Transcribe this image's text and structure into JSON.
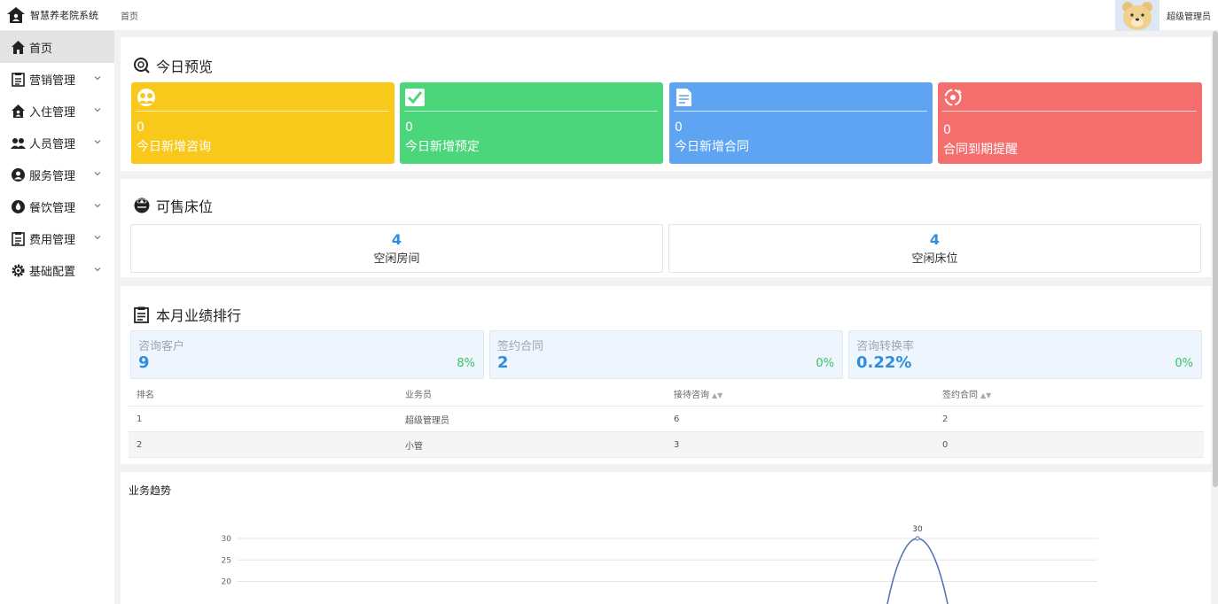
{
  "app": {
    "title": "智慧养老院系统",
    "logo_icon": "house-icon"
  },
  "breadcrumb": "首页",
  "user": {
    "name": "超级管理员",
    "avatar_icon": "bear-avatar"
  },
  "sidebar": {
    "items": [
      {
        "label": "首页",
        "icon": "home-icon",
        "active": true
      },
      {
        "label": "营销管理",
        "icon": "clipboard-icon"
      },
      {
        "label": "入住管理",
        "icon": "house-icon"
      },
      {
        "label": "人员管理",
        "icon": "users-icon"
      },
      {
        "label": "服务管理",
        "icon": "service-icon"
      },
      {
        "label": "餐饮管理",
        "icon": "drop-icon"
      },
      {
        "label": "费用管理",
        "icon": "clipboard-icon"
      },
      {
        "label": "基础配置",
        "icon": "gear-icon"
      }
    ]
  },
  "overview": {
    "title": "今日预览",
    "tiles": [
      {
        "value": "0",
        "label": "今日新增咨询",
        "color": "#f8c81a",
        "icon": "users-icon"
      },
      {
        "value": "0",
        "label": "今日新增预定",
        "color": "#4cd67c",
        "icon": "check-icon"
      },
      {
        "value": "0",
        "label": "今日新增合同",
        "color": "#5ea4f2",
        "icon": "document-icon"
      },
      {
        "value": "0",
        "label": "合同到期提醒",
        "color": "#f56e6e",
        "icon": "reminder-icon"
      }
    ]
  },
  "beds": {
    "title": "可售床位",
    "items": [
      {
        "value": "4",
        "label": "空闲房间"
      },
      {
        "value": "4",
        "label": "空闲床位"
      }
    ]
  },
  "ranking": {
    "title": "本月业绩排行",
    "stats": [
      {
        "label": "咨询客户",
        "value": "9",
        "pct": "8%"
      },
      {
        "label": "签约合同",
        "value": "2",
        "pct": "0%"
      },
      {
        "label": "咨询转换率",
        "value": "0.22%",
        "pct": "0%"
      }
    ],
    "columns": [
      "排名",
      "业务员",
      "接待咨询",
      "签约合同"
    ],
    "rows": [
      [
        "1",
        "超级管理员",
        "6",
        "2"
      ],
      [
        "2",
        "小管",
        "3",
        "0"
      ]
    ]
  },
  "trend": {
    "title": "业务趋势",
    "accent": "#4a6fb5"
  },
  "chart_data": {
    "type": "line",
    "title": "业务趋势",
    "y_ticks": [
      30,
      25,
      20
    ],
    "series": [
      {
        "points": [
          {
            "y": 30,
            "label": "30"
          }
        ]
      }
    ]
  }
}
